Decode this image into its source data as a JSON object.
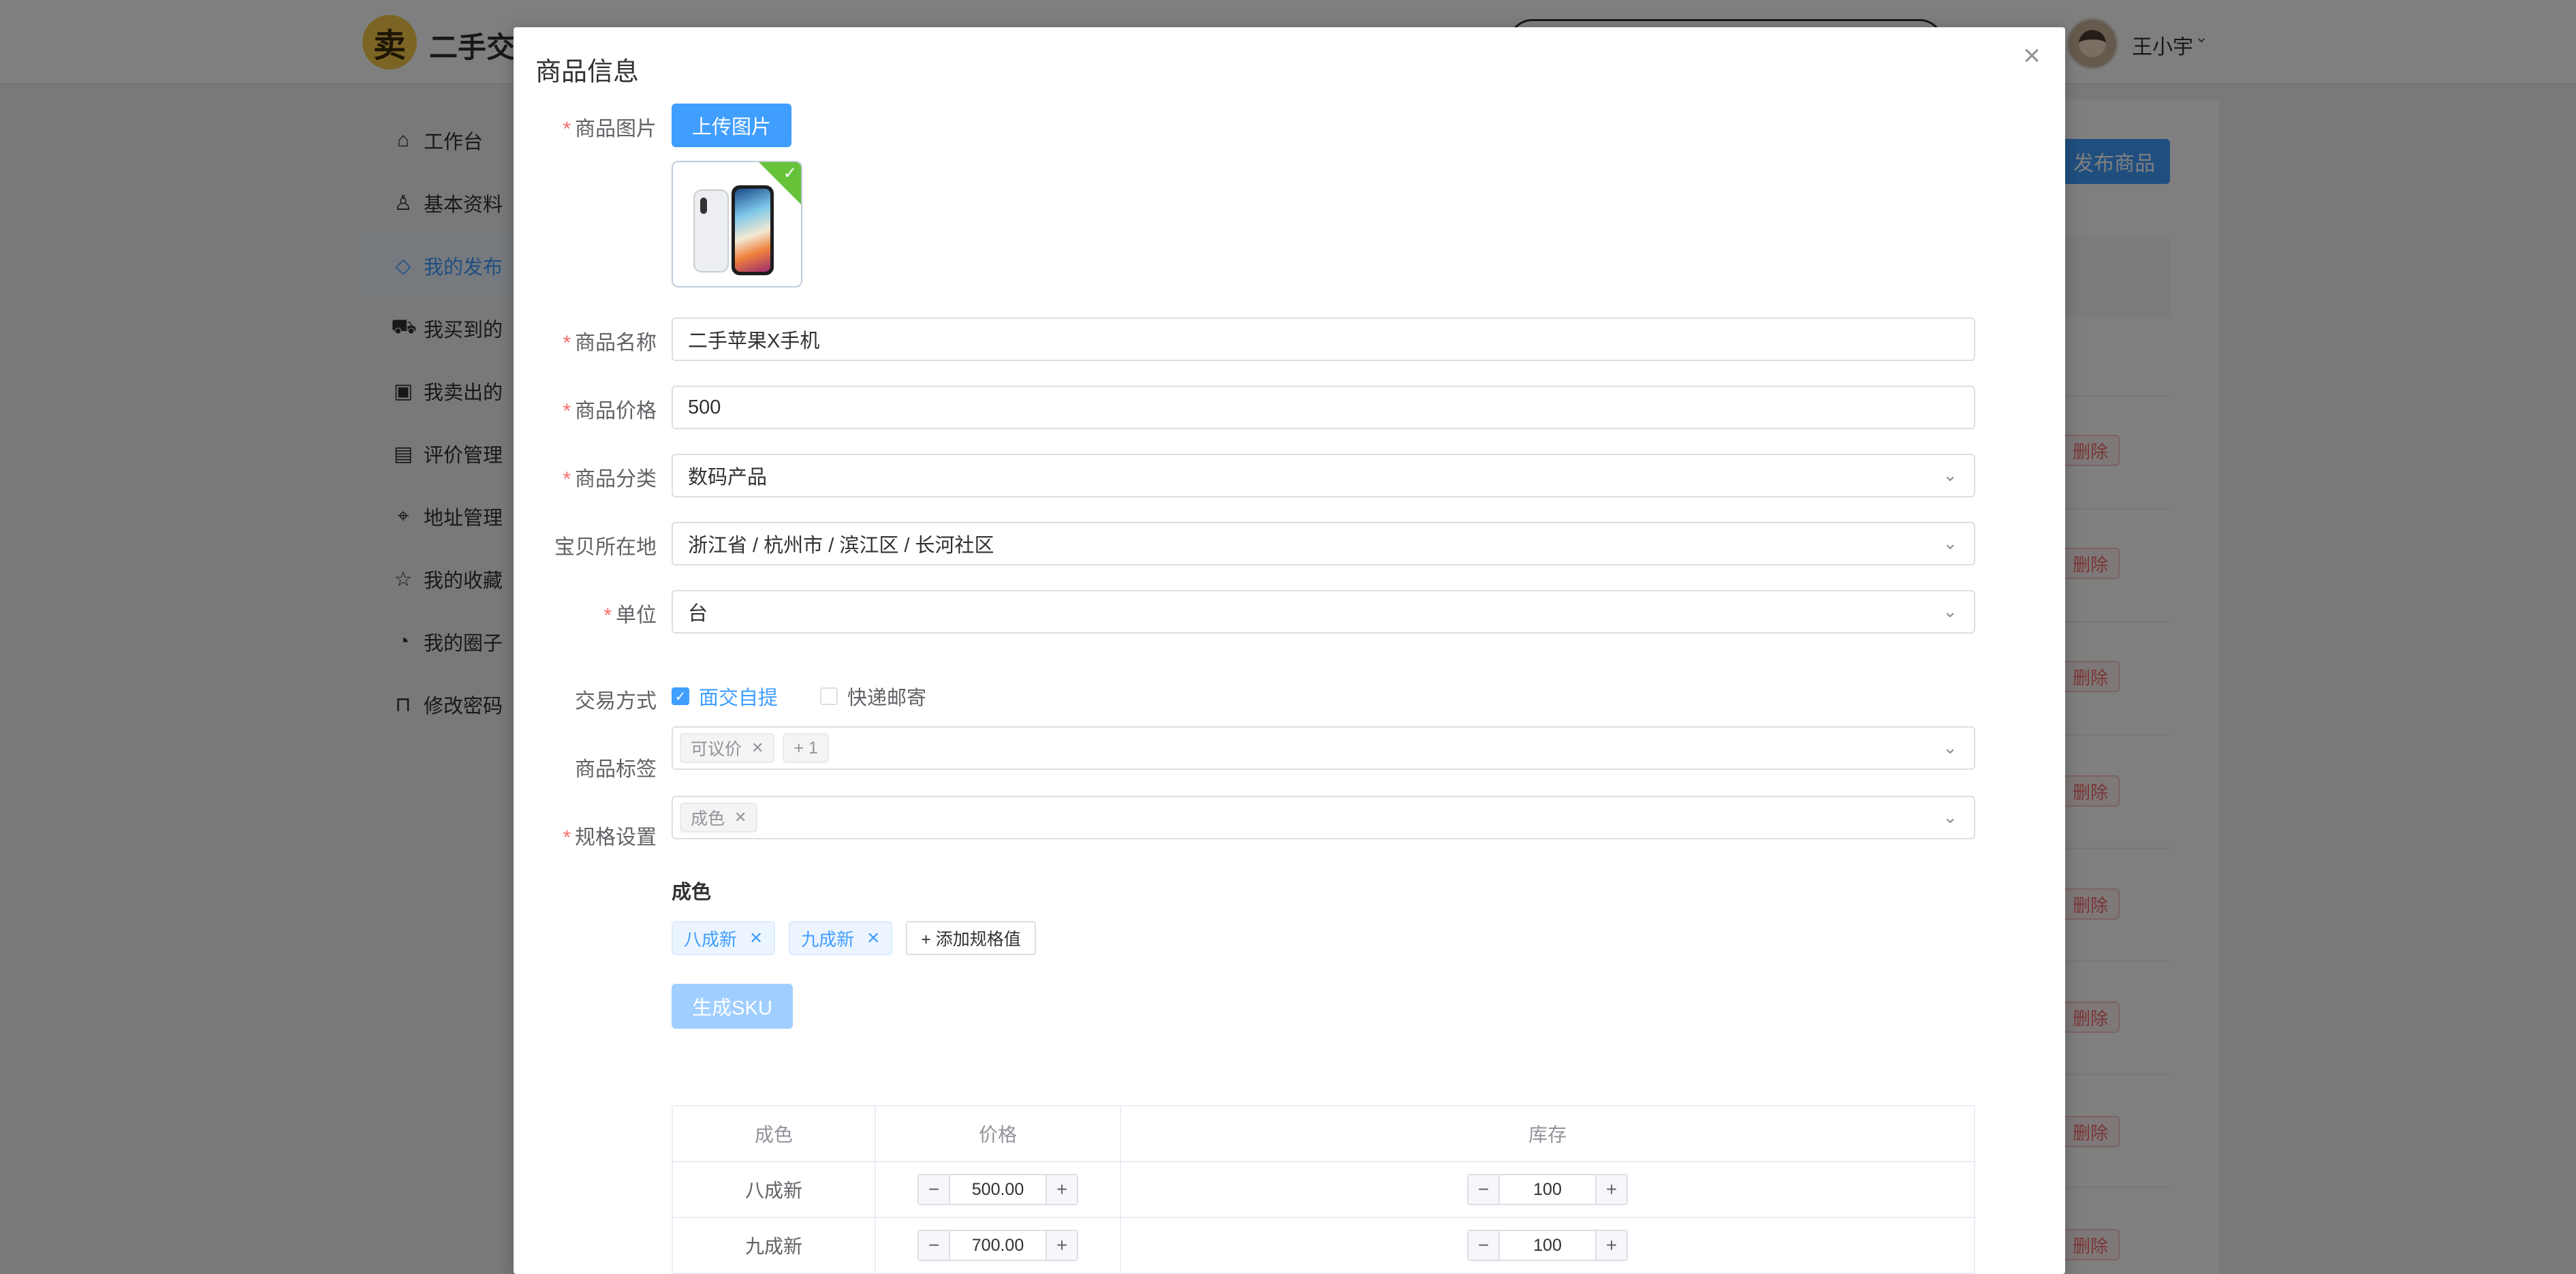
{
  "app": {
    "logo_char": "卖",
    "brand": "二手交",
    "username": "王小宇"
  },
  "sidebar": {
    "items": [
      {
        "label": "工作台",
        "icon": "home-icon",
        "glyph": "⌂"
      },
      {
        "label": "基本资料",
        "icon": "user-icon",
        "glyph": "♙"
      },
      {
        "label": "我的发布",
        "icon": "bag-icon",
        "glyph": "◇"
      },
      {
        "label": "我买到的",
        "icon": "cart-icon",
        "glyph": "⛟"
      },
      {
        "label": "我卖出的",
        "icon": "box-icon",
        "glyph": "▣"
      },
      {
        "label": "评价管理",
        "icon": "comment-icon",
        "glyph": "▤"
      },
      {
        "label": "地址管理",
        "icon": "location-icon",
        "glyph": "⌖"
      },
      {
        "label": "我的收藏",
        "icon": "star-icon",
        "glyph": "☆"
      },
      {
        "label": "我的圈子",
        "icon": "pie-icon",
        "glyph": "◔"
      },
      {
        "label": "修改密码",
        "icon": "lock-icon",
        "glyph": "⊓"
      }
    ]
  },
  "list": {
    "publish_button": "发布商品",
    "delete_label": "删除"
  },
  "dialog": {
    "title": "商品信息",
    "close_glyph": "×",
    "labels": {
      "image": "商品图片",
      "name": "商品名称",
      "price": "商品价格",
      "category": "商品分类",
      "location": "宝贝所在地",
      "unit": "单位",
      "trade": "交易方式",
      "tags": "商品标签",
      "spec": "规格设置"
    },
    "upload_button": "上传图片",
    "fields": {
      "name": "二手苹果X手机",
      "price": "500",
      "category": "数码产品",
      "location": "浙江省 / 杭州市 / 滨江区 / 长河社区",
      "unit": "台"
    },
    "trade": {
      "option1": "面交自提",
      "option1_checked": true,
      "option2": "快递邮寄",
      "option2_checked": false
    },
    "tags": {
      "tag1": "可议价",
      "more": "+ 1"
    },
    "spec": {
      "tag1": "成色",
      "group_title": "成色",
      "values": [
        "八成新",
        "九成新"
      ],
      "add_button": "+ 添加规格值",
      "generate_button": "生成SKU"
    },
    "sku_table": {
      "headers": [
        "成色",
        "价格",
        "库存"
      ],
      "rows": [
        {
          "spec": "八成新",
          "price": "500.00",
          "stock": "100"
        },
        {
          "spec": "九成新",
          "price": "700.00",
          "stock": "100"
        }
      ]
    }
  }
}
